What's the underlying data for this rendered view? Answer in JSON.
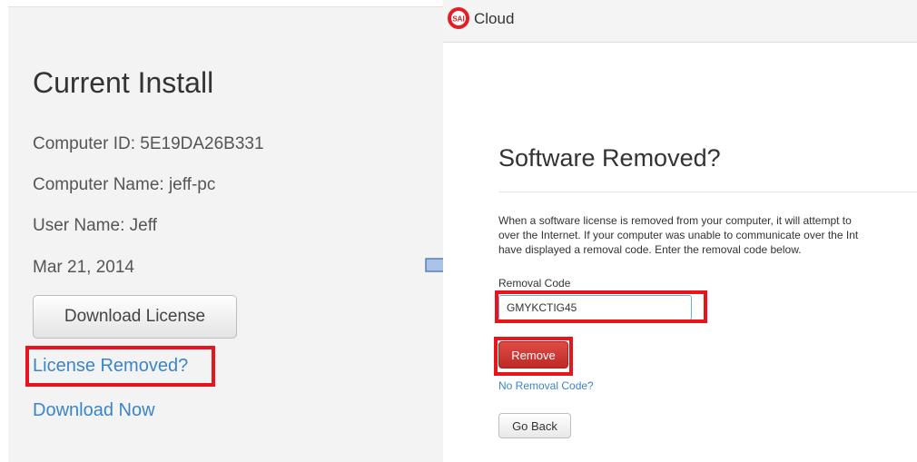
{
  "left_panel": {
    "title": "Current Install",
    "computer_id": "Computer ID: 5E19DA26B331",
    "computer_name": "Computer Name: jeff-pc",
    "user_name": "User Name: Jeff",
    "date": "Mar 21, 2014",
    "download_license_label": "Download License",
    "license_removed_link": "License Removed?",
    "download_now_link": "Download Now"
  },
  "right_panel": {
    "logo_text": "SAI",
    "app_name": "Cloud",
    "title": "Software Removed?",
    "description_lines": [
      "When a software license is removed from your computer, it will attempt to",
      "over the Internet. If your computer was unable to communicate over the Int",
      "have displayed a removal code. Enter the removal code below."
    ],
    "removal_code_label": "Removal Code",
    "removal_code_value": "GMYKCTIG45",
    "remove_label": "Remove",
    "no_removal_code_link": "No Removal Code?",
    "go_back_label": "Go Back"
  },
  "icons": {
    "arrow": "right-arrow-icon",
    "logo": "sai-logo-icon"
  },
  "colors": {
    "highlight": "#e8141b",
    "link": "#3a85c9",
    "remove_button": "#c9302c",
    "arrow_fill": "#a9c4e6"
  }
}
